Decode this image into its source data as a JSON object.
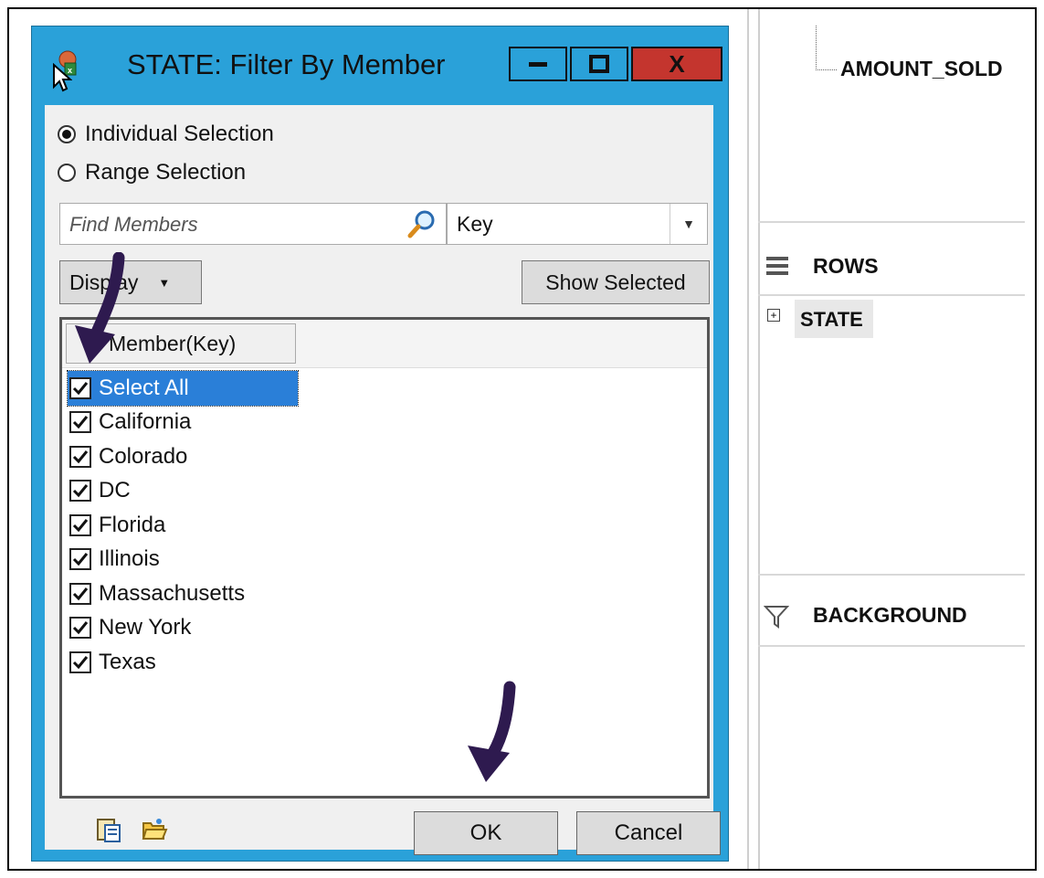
{
  "dialog": {
    "title": "STATE: Filter By Member",
    "close_label": "X",
    "radio_individual": "Individual Selection",
    "radio_range": "Range Selection",
    "find_placeholder": "Find Members",
    "key_value": "Key",
    "display_label": "Display",
    "show_selected_label": "Show Selected",
    "column_header": "Member(Key)",
    "members": [
      {
        "label": "Select All",
        "checked": true,
        "selected": true
      },
      {
        "label": "California",
        "checked": true
      },
      {
        "label": "Colorado",
        "checked": true
      },
      {
        "label": "DC",
        "checked": true
      },
      {
        "label": "Florida",
        "checked": true
      },
      {
        "label": "Illinois",
        "checked": true
      },
      {
        "label": "Massachusetts",
        "checked": true
      },
      {
        "label": "New York",
        "checked": true
      },
      {
        "label": "Texas",
        "checked": true
      }
    ],
    "ok_label": "OK",
    "cancel_label": "Cancel"
  },
  "right_panel": {
    "measure_item": "AMOUNT_SOLD",
    "rows_label": "ROWS",
    "rows_item": "STATE",
    "background_label": "BACKGROUND"
  },
  "colors": {
    "title_bar": "#2aa1d9",
    "close_button": "#c4352e",
    "selection": "#2a7fd8",
    "annotation_arrow": "#2e1a4f"
  }
}
